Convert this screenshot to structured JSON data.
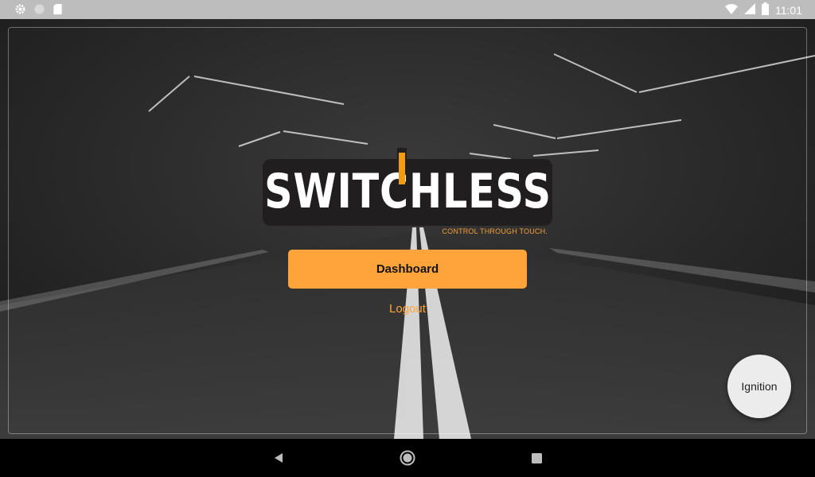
{
  "status_bar": {
    "time": "11:01",
    "left_icons": [
      "gear-icon",
      "circle-icon",
      "sd-card-icon"
    ],
    "right_icons": [
      "wifi-icon",
      "signal-icon",
      "battery-icon"
    ]
  },
  "logo": {
    "wordmark": "SWITCHLESS",
    "tagline": "CONTROL THROUGH TOUCH.",
    "accent_color": "#f39c12"
  },
  "main": {
    "dashboard_label": "Dashboard",
    "logout_label": "Logout"
  },
  "fab": {
    "ignition_label": "Ignition"
  },
  "nav_bar": {
    "icons": [
      "back-icon",
      "home-icon",
      "recents-icon"
    ]
  },
  "colors": {
    "primary": "#ffa43a",
    "background": "#262626"
  }
}
